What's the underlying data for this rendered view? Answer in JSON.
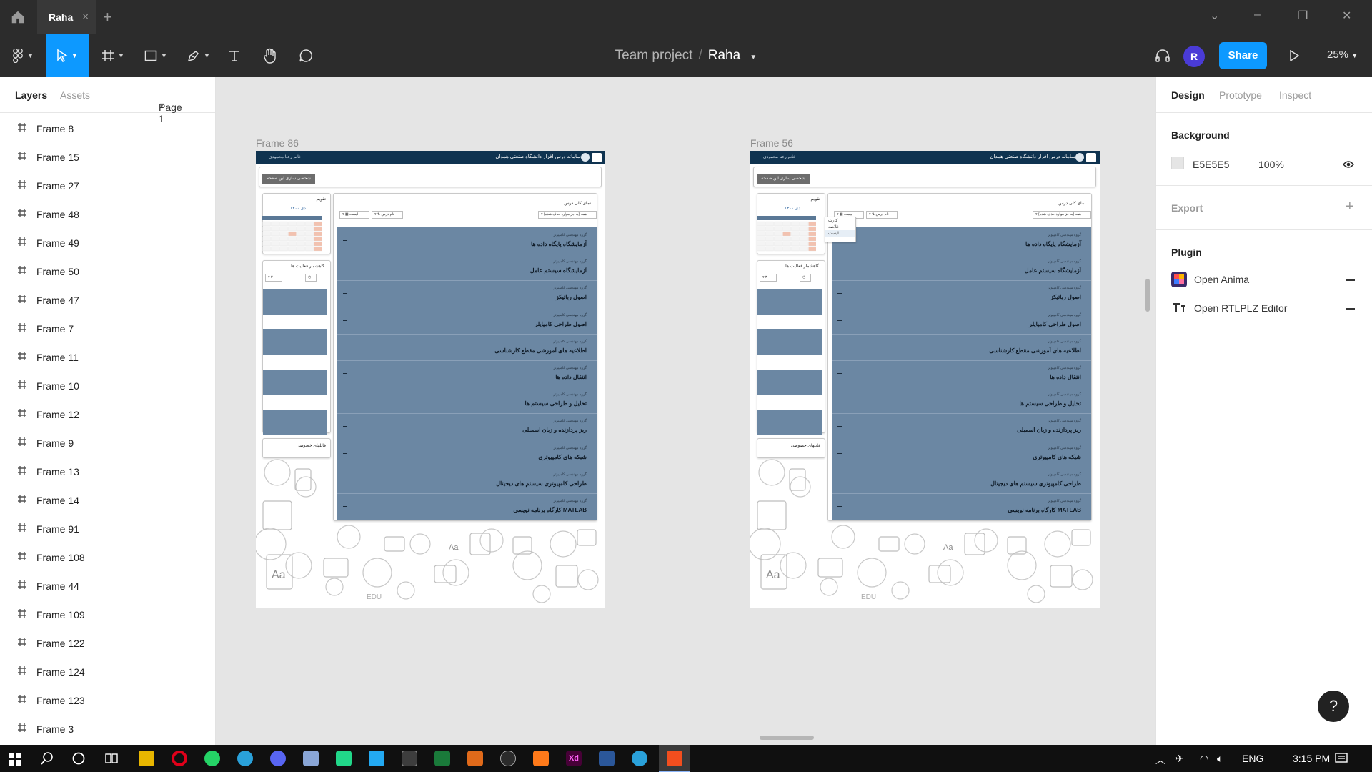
{
  "titlebar": {
    "tab_title": "Raha",
    "tab_close": "×",
    "new_tab": "+",
    "window_controls": {
      "chevron": "⌄",
      "minimize": "–",
      "restore": "❐",
      "close": "✕"
    }
  },
  "toolbar": {
    "project": "Team project",
    "separator": "/",
    "file": "Raha",
    "avatar_letter": "R",
    "share_label": "Share",
    "zoom": "25%"
  },
  "left_panel": {
    "tab_layers": "Layers",
    "tab_assets": "Assets",
    "page_selector": "Page 1",
    "layers": [
      "Frame 8",
      "Frame 15",
      "Frame 27",
      "Frame 48",
      "Frame 49",
      "Frame 50",
      "Frame 47",
      "Frame 7",
      "Frame 11",
      "Frame 10",
      "Frame 12",
      "Frame 9",
      "Frame 13",
      "Frame 14",
      "Frame 91",
      "Frame 108",
      "Frame 44",
      "Frame 109",
      "Frame 122",
      "Frame 124",
      "Frame 123",
      "Frame 3"
    ]
  },
  "right_panel": {
    "tab_design": "Design",
    "tab_prototype": "Prototype",
    "tab_inspect": "Inspect",
    "background_heading": "Background",
    "background_hex": "E5E5E5",
    "background_opacity": "100%",
    "export_heading": "Export",
    "plugin_heading": "Plugin",
    "plugins": [
      "Open Anima",
      "Open RTLPLZ Editor"
    ]
  },
  "canvas": {
    "frames": [
      {
        "label": "Frame 86",
        "dropdown_open": false
      },
      {
        "label": "Frame 56",
        "dropdown_open": true
      }
    ],
    "site_title": "سامانه درس افزار دانشگاه صنعتی همدان",
    "user_label": "خانم رعنا محمودی",
    "customize_button": "شخصی سازی این صفحه",
    "calendar_title": "تقویم",
    "calendar_month": "دی ۱۴۰۰",
    "activity_title": "گاهشمار فعالیت ها",
    "overview_title": "نمای کلی درس",
    "filter_all": "همه (به جز موارد حذف شده)",
    "sort_label": "نام درس",
    "view_label": "لیست",
    "view_options": [
      "کارت",
      "خلاصه",
      "لیست"
    ],
    "private_files": "فایلهای خصوصی",
    "course_dept": "گروه مهندسی کامپیوتر",
    "courses": [
      "آزمایشگاه پایگاه داده ها",
      "آزمایشگاه سیستم عامل",
      "اصول رباتیکز",
      "اصول طراحی کامپایلر",
      "اطلاعیه های آموزشی مقطع کارشناسی",
      "انتقال داده ها",
      "تحلیل و طراحی سیستم ها",
      "ریز پردازنده و زبان اسمبلی",
      "شبکه های کامپیوتری",
      "طراحی کامپیوتری سیستم های دیجیتال",
      "کارگاه برنامه نویسی MATLAB"
    ]
  },
  "taskbar": {
    "language": "ENG",
    "time": "3:15 PM"
  },
  "help_label": "?"
}
